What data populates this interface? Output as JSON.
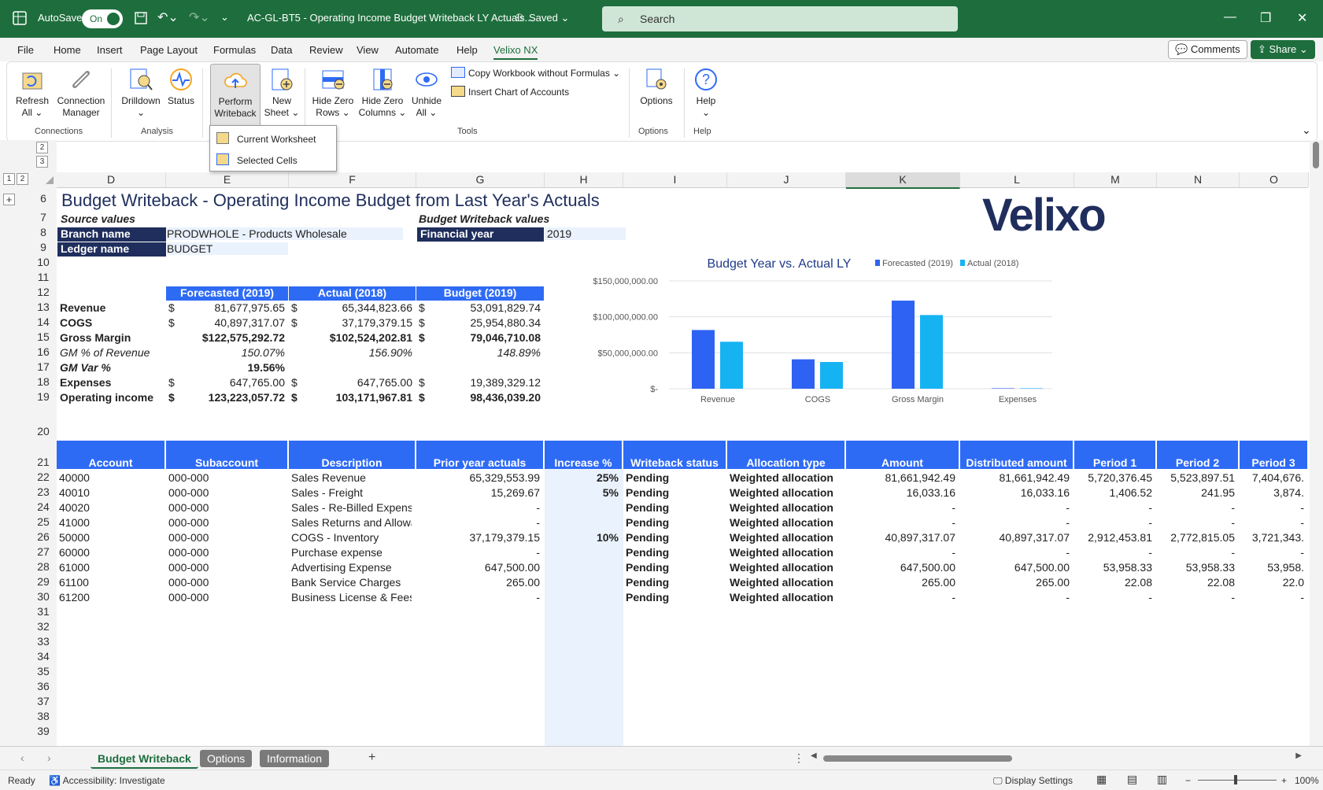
{
  "titlebar": {
    "autosave_label": "AutoSave",
    "autosave_state": "On",
    "filename": "AC-GL-BT5 - Operating Income Budget Writeback LY Actuals...",
    "saved": "Saved",
    "search_placeholder": "Search"
  },
  "menu": {
    "items": [
      "File",
      "Home",
      "Insert",
      "Page Layout",
      "Formulas",
      "Data",
      "Review",
      "View",
      "Automate",
      "Help",
      "Velixo NX"
    ],
    "comments": "Comments",
    "share": "Share"
  },
  "ribbon": {
    "refresh": [
      "Refresh",
      "All ⌄"
    ],
    "connection": [
      "Connection",
      "Manager"
    ],
    "drilldown": [
      "Drilldown",
      "⌄"
    ],
    "status": [
      "Status"
    ],
    "perform": [
      "Perform",
      "Writeback ⌄"
    ],
    "newsheet": [
      "New",
      "Sheet ⌄"
    ],
    "hidezerorows": [
      "Hide Zero",
      "Rows ⌄"
    ],
    "hidezerocols": [
      "Hide Zero",
      "Columns ⌄"
    ],
    "unhide": [
      "Unhide",
      "All ⌄"
    ],
    "copy": "Copy Workbook without Formulas ⌄",
    "insertchart": "Insert Chart of Accounts",
    "options": [
      "Options"
    ],
    "help": [
      "Help",
      "⌄"
    ],
    "groups": [
      "Connections",
      "Analysis",
      "Tools",
      "Options",
      "Help"
    ]
  },
  "dropdown": {
    "items": [
      "Current Worksheet",
      "Selected Cells"
    ]
  },
  "outline": {
    "rows": [
      "2",
      "3"
    ],
    "levels": [
      "1",
      "2"
    ],
    "expand": "+"
  },
  "columns": [
    "D",
    "E",
    "F",
    "G",
    "H",
    "I",
    "J",
    "K",
    "L",
    "M",
    "N",
    "O"
  ],
  "row_numbers": [
    "6",
    "7",
    "8",
    "9",
    "10",
    "11",
    "12",
    "13",
    "14",
    "15",
    "16",
    "17",
    "18",
    "19",
    "20",
    "21",
    "22",
    "23",
    "24",
    "25",
    "26",
    "27",
    "28",
    "29",
    "30",
    "31",
    "32",
    "33",
    "34",
    "35",
    "36",
    "37",
    "38",
    "39"
  ],
  "sheet": {
    "title": "Budget Writeback - Operating Income Budget from Last Year's Actuals",
    "source_values": "Source values",
    "branch_label": "Branch name",
    "branch_value": "PRODWHOLE - Products Wholesale",
    "ledger_label": "Ledger name",
    "ledger_value": "BUDGET",
    "budget_values": "Budget Writeback values",
    "fy_label": "Financial year",
    "fy_value": "2019",
    "logo": "Velixo",
    "summary_headers": [
      "Forecasted (2019)",
      "Actual (2018)",
      "Budget (2019)"
    ],
    "summary_rows": [
      {
        "label": "Revenue",
        "f": "81,677,975.65",
        "a": "65,344,823.66",
        "b": "53,091,829.74",
        "fs": "$",
        "as": "$",
        "bs": "$"
      },
      {
        "label": "COGS",
        "f": "40,897,317.07",
        "a": "37,179,379.15",
        "b": "25,954,880.34",
        "fs": "$",
        "as": "$",
        "bs": "$"
      },
      {
        "label": "Gross Margin",
        "f": "$122,575,292.72",
        "a": "$102,524,202.81",
        "b": "79,046,710.08",
        "fs": "",
        "as": "",
        "bs": "$"
      },
      {
        "label": "GM % of Revenue",
        "f": "150.07%",
        "a": "156.90%",
        "b": "148.89%",
        "fs": "",
        "as": "",
        "bs": ""
      },
      {
        "label": "GM Var %",
        "f": "19.56%",
        "a": "",
        "b": "",
        "fs": "",
        "as": "",
        "bs": ""
      },
      {
        "label": "Expenses",
        "f": "647,765.00",
        "a": "647,765.00",
        "b": "19,389,329.12",
        "fs": "$",
        "as": "$",
        "bs": "$"
      },
      {
        "label": "Operating income",
        "f": "123,223,057.72",
        "a": "103,171,967.81",
        "b": "98,436,039.20",
        "fs": "$",
        "as": "$",
        "bs": "$"
      }
    ],
    "table_headers": [
      "Account",
      "Subaccount",
      "Description",
      "Prior year actuals",
      "Increase %",
      "Writeback status",
      "Allocation type",
      "Amount",
      "Distributed amount",
      "Period 1",
      "Period 2",
      "Period 3"
    ],
    "table_rows": [
      [
        "40000",
        "000-000",
        "Sales Revenue",
        "65,329,553.99",
        "25%",
        "Pending",
        "Weighted allocation",
        "81,661,942.49",
        "81,661,942.49",
        "5,720,376.45",
        "5,523,897.51",
        "7,404,676."
      ],
      [
        "40010",
        "000-000",
        "Sales - Freight",
        "15,269.67",
        "5%",
        "Pending",
        "Weighted allocation",
        "16,033.16",
        "16,033.16",
        "1,406.52",
        "241.95",
        "3,874."
      ],
      [
        "40020",
        "000-000",
        "Sales - Re-Billed Expense",
        "-",
        "",
        "Pending",
        "Weighted allocation",
        "-",
        "-",
        "-",
        "-",
        "-"
      ],
      [
        "41000",
        "000-000",
        "Sales Returns and Allowa",
        "-",
        "",
        "Pending",
        "Weighted allocation",
        "-",
        "-",
        "-",
        "-",
        "-"
      ],
      [
        "50000",
        "000-000",
        "COGS - Inventory",
        "37,179,379.15",
        "10%",
        "Pending",
        "Weighted allocation",
        "40,897,317.07",
        "40,897,317.07",
        "2,912,453.81",
        "2,772,815.05",
        "3,721,343."
      ],
      [
        "60000",
        "000-000",
        "Purchase expense",
        "-",
        "",
        "Pending",
        "Weighted allocation",
        "-",
        "-",
        "-",
        "-",
        "-"
      ],
      [
        "61000",
        "000-000",
        "Advertising Expense",
        "647,500.00",
        "",
        "Pending",
        "Weighted allocation",
        "647,500.00",
        "647,500.00",
        "53,958.33",
        "53,958.33",
        "53,958."
      ],
      [
        "61100",
        "000-000",
        "Bank Service Charges",
        "265.00",
        "",
        "Pending",
        "Weighted allocation",
        "265.00",
        "265.00",
        "22.08",
        "22.08",
        "22.0"
      ],
      [
        "61200",
        "000-000",
        "Business License & Fees",
        "-",
        "",
        "Pending",
        "Weighted allocation",
        "-",
        "-",
        "-",
        "-",
        "-"
      ]
    ]
  },
  "chart_data": {
    "type": "bar",
    "title": "Budget Year vs. Actual LY",
    "categories": [
      "Revenue",
      "COGS",
      "Gross Margin",
      "Expenses"
    ],
    "series": [
      {
        "name": "Forecasted (2019)",
        "color": "#2e62f2",
        "values": [
          81677975.65,
          40897317.07,
          122575292.72,
          647765
        ]
      },
      {
        "name": "Actual (2018)",
        "color": "#16b3f2",
        "values": [
          65344823.66,
          37179379.15,
          102524202.81,
          647765
        ]
      }
    ],
    "y_ticks": [
      0,
      50000000,
      100000000,
      150000000
    ],
    "y_tick_labels": [
      "$-",
      "$50,000,000.00",
      "$100,000,000.00",
      "$150,000,000.00"
    ],
    "ylim": [
      0,
      150000000
    ],
    "legend": "top-right",
    "grid": true
  },
  "tabs": [
    "Budget Writeback",
    "Options",
    "Information"
  ],
  "add_sheet": "+",
  "status": {
    "ready": "Ready",
    "accessibility": "Accessibility: Investigate",
    "display": "Display Settings",
    "zoom": "100%"
  }
}
